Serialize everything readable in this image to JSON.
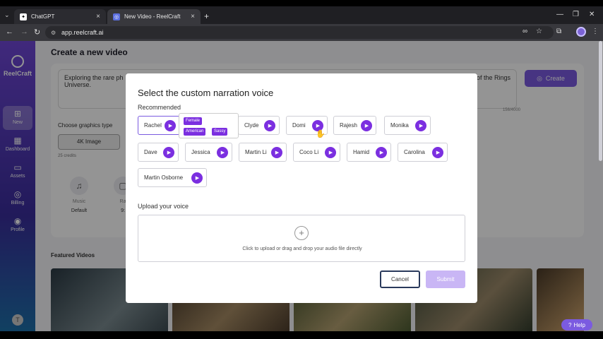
{
  "browser": {
    "tabs": [
      {
        "title": "ChatGPT"
      },
      {
        "title": "New Video - ReelCraft"
      }
    ],
    "url": "app.reelcraft.ai"
  },
  "sidebar": {
    "brand": "ReelCraft",
    "items": [
      {
        "label": "New"
      },
      {
        "label": "Dashboard"
      },
      {
        "label": "Assets"
      },
      {
        "label": "Billing"
      },
      {
        "label": "Profile"
      }
    ],
    "user_initial": "T"
  },
  "main": {
    "title": "Create a new video",
    "prompt_left": "Exploring the rare ph",
    "prompt_right": "of the Rings",
    "prompt_line2": "Universe.",
    "char_counter": "156/4000",
    "create_label": "Create",
    "graphics_label": "Choose graphics type",
    "graphics_option": "4K Image",
    "credits": "25 credits",
    "music_label": "Music",
    "music_value": "Default",
    "second_label": "Ra",
    "second_value": "9:",
    "featured_label": "Featured Videos",
    "help_label": "Help"
  },
  "modal": {
    "title": "Select the custom narration voice",
    "recommended_label": "Recommended",
    "voices": [
      {
        "name": "Rachel"
      },
      {
        "name": "Clyde"
      },
      {
        "name": "Domi"
      },
      {
        "name": "Rajesh"
      },
      {
        "name": "Monika"
      },
      {
        "name": "Dave"
      },
      {
        "name": "Jessica"
      },
      {
        "name": "Martin Li"
      },
      {
        "name": "Coco Li"
      },
      {
        "name": "Hamid"
      },
      {
        "name": "Carolina"
      },
      {
        "name": "Martin Osborne"
      }
    ],
    "tooltip_tags": [
      "Female",
      "American",
      "Sassy"
    ],
    "upload_label": "Upload your voice",
    "upload_hint": "Click to upload or drag and drop your audio file directly",
    "cancel_label": "Cancel",
    "submit_label": "Submit"
  },
  "colors": {
    "accent": "#7b2fe0",
    "brand": "#7b5be0"
  }
}
